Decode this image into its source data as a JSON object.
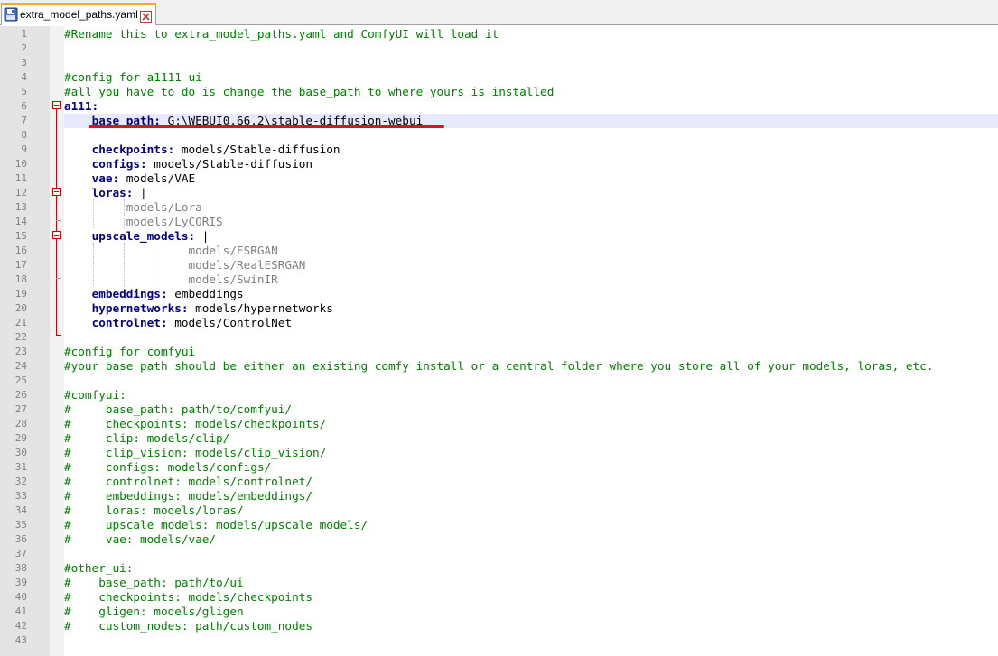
{
  "tab": {
    "title": "extra_model_paths.yaml",
    "icon": "floppy-disk-icon",
    "close_icon": "close-x-icon"
  },
  "colors": {
    "comment": "#008000",
    "key": "#000080",
    "fold_marker": "#cc0000",
    "current_line": "#e8e8ff",
    "annotation_underline": "#e0101c"
  },
  "lines": [
    {
      "n": "1",
      "parts": [
        {
          "t": "#Rename this to extra_model_paths.yaml and ComfyUI will load it",
          "c": "comment"
        }
      ]
    },
    {
      "n": "2",
      "parts": []
    },
    {
      "n": "3",
      "parts": []
    },
    {
      "n": "4",
      "parts": [
        {
          "t": "#config for a1111 ui",
          "c": "comment"
        }
      ]
    },
    {
      "n": "5",
      "parts": [
        {
          "t": "#all you have to do is change the base_path to where yours is installed",
          "c": "comment"
        }
      ]
    },
    {
      "n": "6",
      "parts": [
        {
          "t": "a111:",
          "c": "key"
        }
      ]
    },
    {
      "n": "7",
      "parts": [
        {
          "t": "    ",
          "c": "val"
        },
        {
          "t": "base_path:",
          "c": "key"
        },
        {
          "t": " G:\\WEBUI0.66.2\\stable-diffusion-webui",
          "c": "val"
        }
      ]
    },
    {
      "n": "8",
      "parts": []
    },
    {
      "n": "9",
      "parts": [
        {
          "t": "    ",
          "c": "val"
        },
        {
          "t": "checkpoints:",
          "c": "key"
        },
        {
          "t": " models/Stable-diffusion",
          "c": "val"
        }
      ]
    },
    {
      "n": "10",
      "parts": [
        {
          "t": "    ",
          "c": "val"
        },
        {
          "t": "configs:",
          "c": "key"
        },
        {
          "t": " models/Stable-diffusion",
          "c": "val"
        }
      ]
    },
    {
      "n": "11",
      "parts": [
        {
          "t": "    ",
          "c": "val"
        },
        {
          "t": "vae:",
          "c": "key"
        },
        {
          "t": " models/VAE",
          "c": "val"
        }
      ]
    },
    {
      "n": "12",
      "parts": [
        {
          "t": "    ",
          "c": "val"
        },
        {
          "t": "loras:",
          "c": "key"
        },
        {
          "t": " |",
          "c": "val"
        }
      ]
    },
    {
      "n": "13",
      "parts": [
        {
          "t": "         models/Lora",
          "c": "block"
        }
      ]
    },
    {
      "n": "14",
      "parts": [
        {
          "t": "         models/LyCORIS",
          "c": "block"
        }
      ]
    },
    {
      "n": "15",
      "parts": [
        {
          "t": "    ",
          "c": "val"
        },
        {
          "t": "upscale_models:",
          "c": "key"
        },
        {
          "t": " |",
          "c": "val"
        }
      ]
    },
    {
      "n": "16",
      "parts": [
        {
          "t": "                  models/ESRGAN",
          "c": "block"
        }
      ]
    },
    {
      "n": "17",
      "parts": [
        {
          "t": "                  models/RealESRGAN",
          "c": "block"
        }
      ]
    },
    {
      "n": "18",
      "parts": [
        {
          "t": "                  models/SwinIR",
          "c": "block"
        }
      ]
    },
    {
      "n": "19",
      "parts": [
        {
          "t": "    ",
          "c": "val"
        },
        {
          "t": "embeddings:",
          "c": "key"
        },
        {
          "t": " embeddings",
          "c": "val"
        }
      ]
    },
    {
      "n": "20",
      "parts": [
        {
          "t": "    ",
          "c": "val"
        },
        {
          "t": "hypernetworks:",
          "c": "key"
        },
        {
          "t": " models/hypernetworks",
          "c": "val"
        }
      ]
    },
    {
      "n": "21",
      "parts": [
        {
          "t": "    ",
          "c": "val"
        },
        {
          "t": "controlnet:",
          "c": "key"
        },
        {
          "t": " models/ControlNet",
          "c": "val"
        }
      ]
    },
    {
      "n": "22",
      "parts": []
    },
    {
      "n": "23",
      "parts": [
        {
          "t": "#config for comfyui",
          "c": "comment"
        }
      ]
    },
    {
      "n": "24",
      "parts": [
        {
          "t": "#your base path should be either an existing comfy install or a central folder where you store all of your models, loras, etc.",
          "c": "comment"
        }
      ]
    },
    {
      "n": "25",
      "parts": []
    },
    {
      "n": "26",
      "parts": [
        {
          "t": "#comfyui:",
          "c": "comment"
        }
      ]
    },
    {
      "n": "27",
      "parts": [
        {
          "t": "#     base_path: path/to/comfyui/",
          "c": "comment"
        }
      ]
    },
    {
      "n": "28",
      "parts": [
        {
          "t": "#     checkpoints: models/checkpoints/",
          "c": "comment"
        }
      ]
    },
    {
      "n": "29",
      "parts": [
        {
          "t": "#     clip: models/clip/",
          "c": "comment"
        }
      ]
    },
    {
      "n": "30",
      "parts": [
        {
          "t": "#     clip_vision: models/clip_vision/",
          "c": "comment"
        }
      ]
    },
    {
      "n": "31",
      "parts": [
        {
          "t": "#     configs: models/configs/",
          "c": "comment"
        }
      ]
    },
    {
      "n": "32",
      "parts": [
        {
          "t": "#     controlnet: models/controlnet/",
          "c": "comment"
        }
      ]
    },
    {
      "n": "33",
      "parts": [
        {
          "t": "#     embeddings: models/embeddings/",
          "c": "comment"
        }
      ]
    },
    {
      "n": "34",
      "parts": [
        {
          "t": "#     loras: models/loras/",
          "c": "comment"
        }
      ]
    },
    {
      "n": "35",
      "parts": [
        {
          "t": "#     upscale_models: models/upscale_models/",
          "c": "comment"
        }
      ]
    },
    {
      "n": "36",
      "parts": [
        {
          "t": "#     vae: models/vae/",
          "c": "comment"
        }
      ]
    },
    {
      "n": "37",
      "parts": []
    },
    {
      "n": "38",
      "parts": [
        {
          "t": "#other_ui:",
          "c": "comment"
        }
      ]
    },
    {
      "n": "39",
      "parts": [
        {
          "t": "#    base_path: path/to/ui",
          "c": "comment"
        }
      ]
    },
    {
      "n": "40",
      "parts": [
        {
          "t": "#    checkpoints: models/checkpoints",
          "c": "comment"
        }
      ]
    },
    {
      "n": "41",
      "parts": [
        {
          "t": "#    gligen: models/gligen",
          "c": "comment"
        }
      ]
    },
    {
      "n": "42",
      "parts": [
        {
          "t": "#    custom_nodes: path/custom_nodes",
          "c": "comment"
        }
      ]
    },
    {
      "n": "43",
      "parts": []
    }
  ]
}
